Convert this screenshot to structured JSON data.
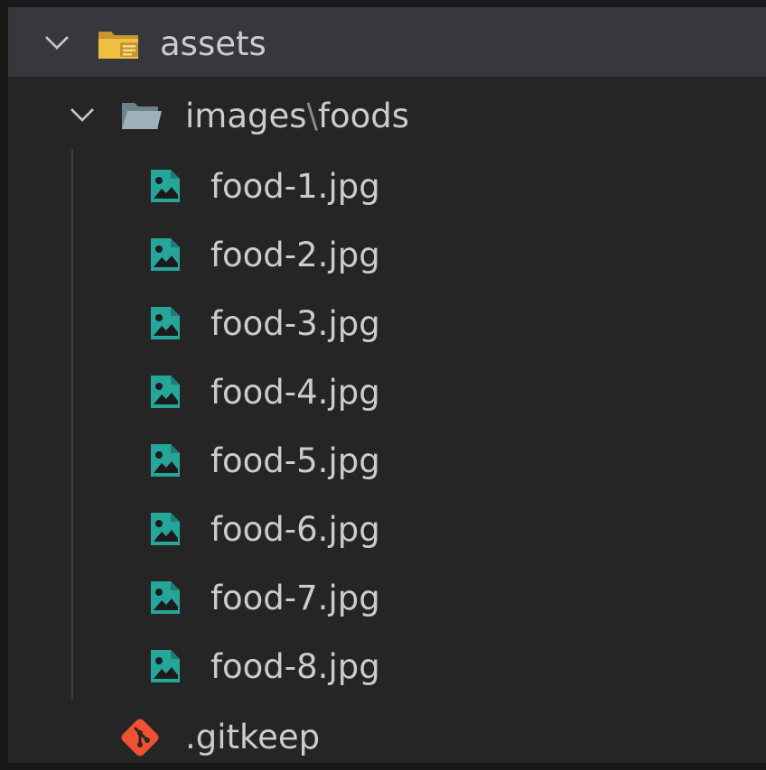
{
  "explorer": {
    "root_folder": {
      "label": "assets",
      "expanded": true,
      "icon": "folder-open-icon",
      "icon_color": "#e8b84a"
    },
    "subfolder": {
      "path_part_1": "images",
      "separator": "\\",
      "path_part_2": "foods",
      "expanded": true,
      "icon": "folder-open-icon",
      "icon_color": "#90a4ae"
    },
    "files": [
      {
        "label": "food-1.jpg",
        "icon": "image-file-icon"
      },
      {
        "label": "food-2.jpg",
        "icon": "image-file-icon"
      },
      {
        "label": "food-3.jpg",
        "icon": "image-file-icon"
      },
      {
        "label": "food-4.jpg",
        "icon": "image-file-icon"
      },
      {
        "label": "food-5.jpg",
        "icon": "image-file-icon"
      },
      {
        "label": "food-6.jpg",
        "icon": "image-file-icon"
      },
      {
        "label": "food-7.jpg",
        "icon": "image-file-icon"
      },
      {
        "label": "food-8.jpg",
        "icon": "image-file-icon"
      }
    ],
    "gitkeep": {
      "label": ".gitkeep",
      "icon": "git-icon",
      "icon_color": "#f05133"
    },
    "colors": {
      "image_icon": "#26a69a",
      "text": "#cccccc",
      "background": "#252526",
      "selection": "#37373d"
    }
  }
}
